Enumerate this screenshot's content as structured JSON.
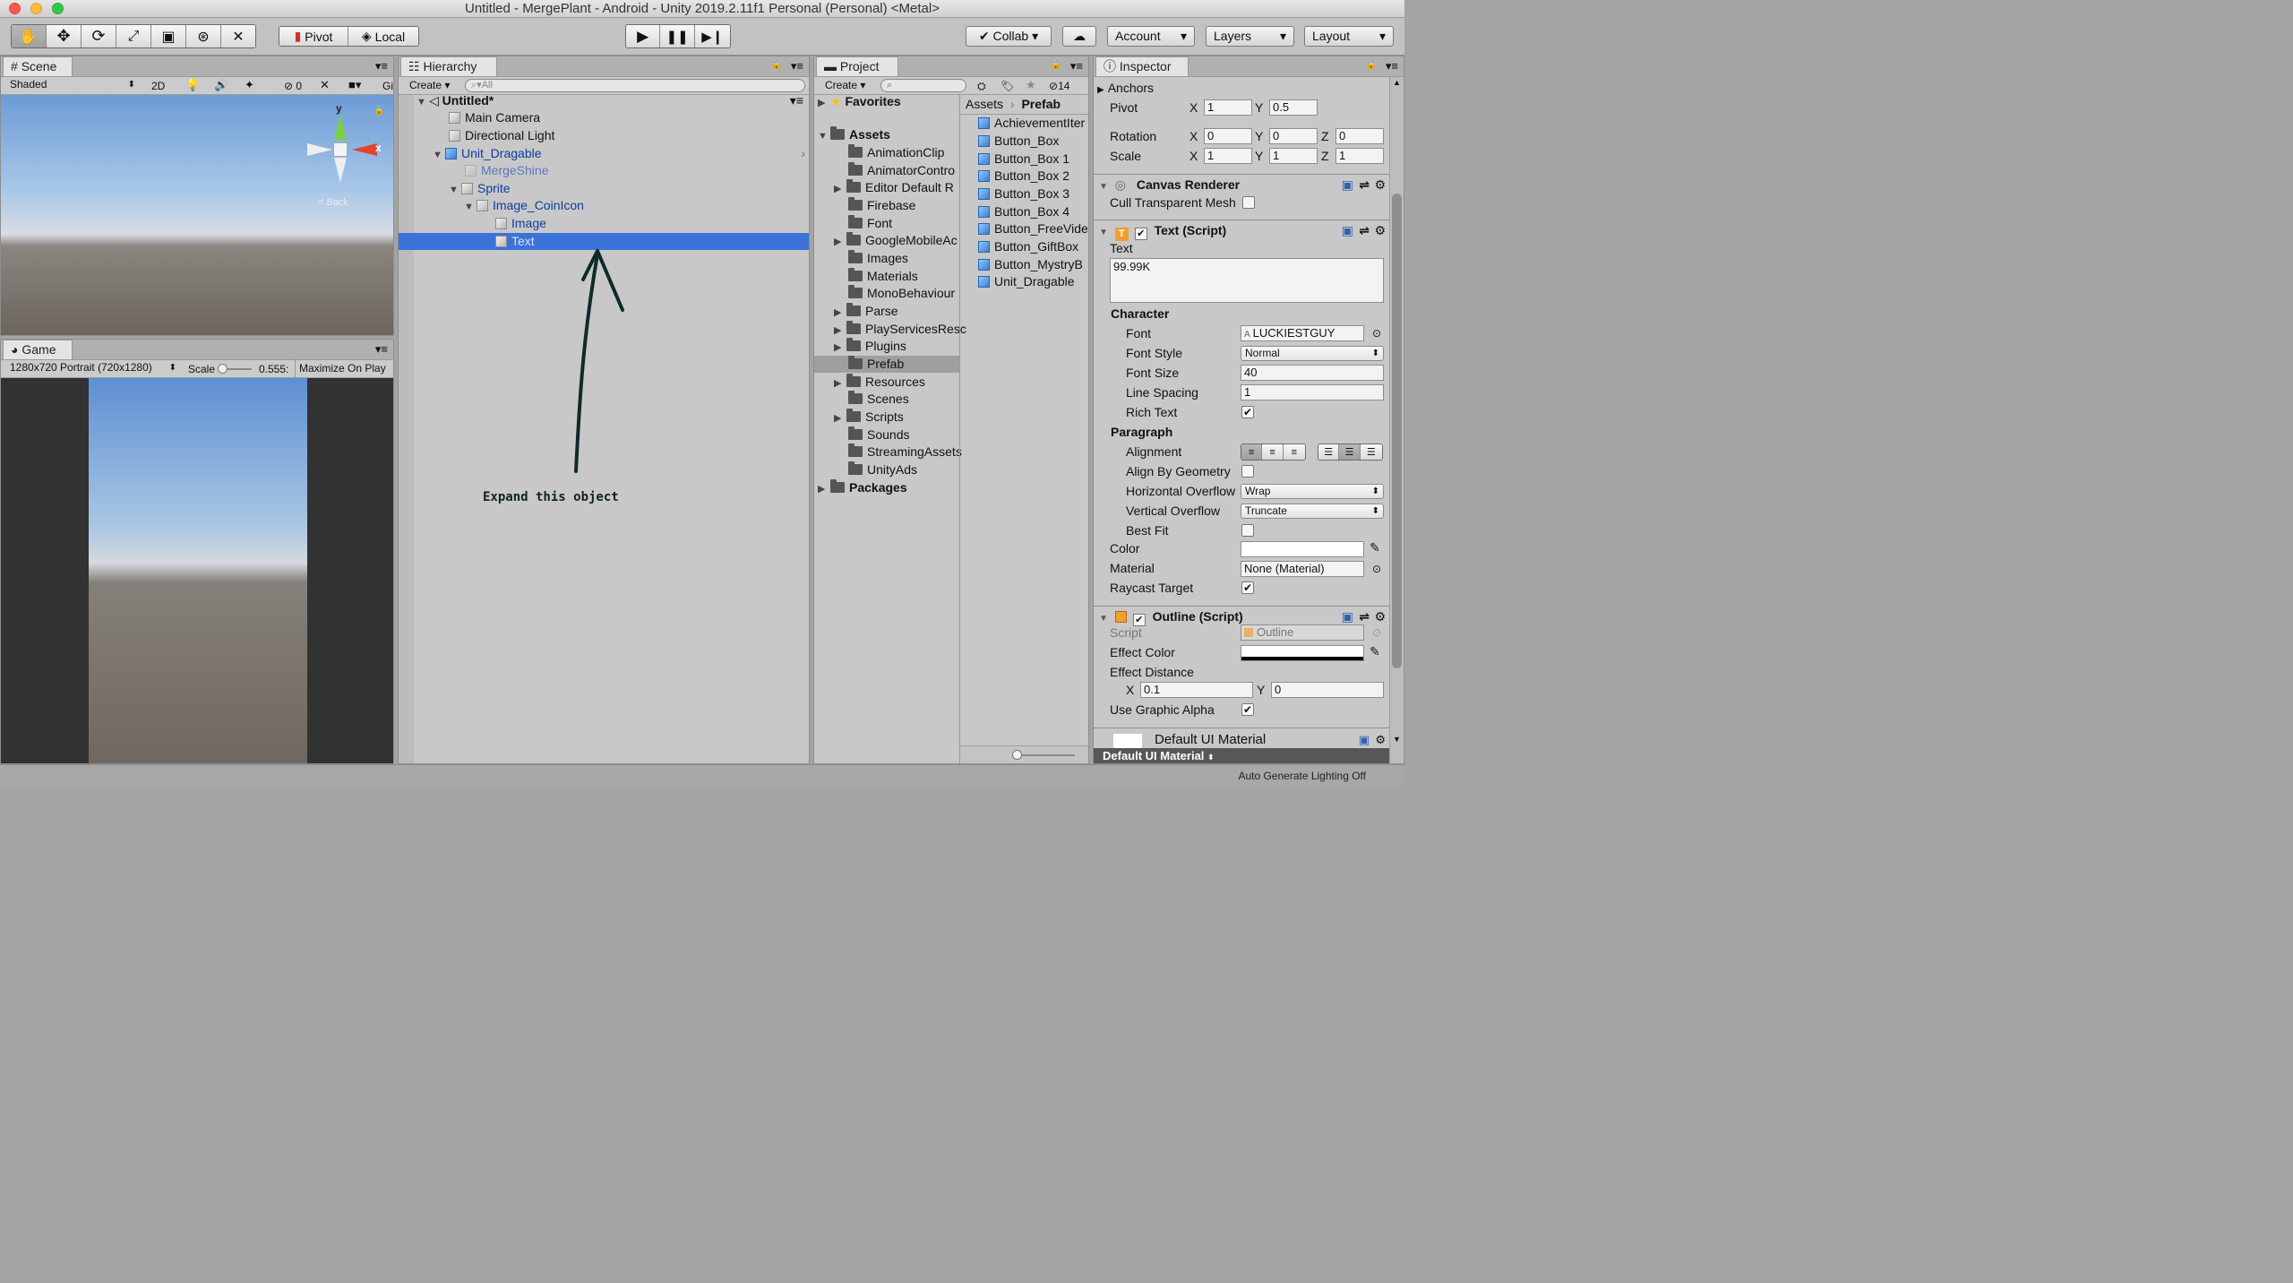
{
  "window": {
    "title": "Untitled - MergePlant - Android - Unity 2019.2.11f1 Personal (Personal) <Metal>"
  },
  "toolbar": {
    "pivot_label": "Pivot",
    "local_label": "Local",
    "collab_label": "Collab",
    "account_label": "Account",
    "layers_label": "Layers",
    "layout_label": "Layout"
  },
  "scene": {
    "tab_label": "Scene",
    "shading_mode": "Shaded",
    "mode_2d": "2D",
    "hidden_count": "0",
    "gizmos_label": "Gi",
    "gizmo_y": "y",
    "gizmo_x": "x",
    "back_label": "< Back"
  },
  "game": {
    "tab_label": "Game",
    "resolution": "1280x720 Portrait (720x1280)",
    "scale_label": "Scale",
    "scale_value": "0.555:",
    "maximize_label": "Maximize On Play"
  },
  "hierarchy": {
    "tab_label": "Hierarchy",
    "create_label": "Create",
    "search_placeholder": "All",
    "scene_name": "Untitled*",
    "items": [
      {
        "label": "Main Camera"
      },
      {
        "label": "Directional Light"
      },
      {
        "label": "Unit_Dragable"
      },
      {
        "label": "MergeShine"
      },
      {
        "label": "Sprite"
      },
      {
        "label": "Image_CoinIcon"
      },
      {
        "label": "Image"
      },
      {
        "label": "Text"
      }
    ],
    "annotation": "Expand this object"
  },
  "project": {
    "tab_label": "Project",
    "create_label": "Create",
    "hidden_count": "14",
    "favorites_label": "Favorites",
    "assets_label": "Assets",
    "packages_label": "Packages",
    "folders": [
      {
        "label": "AnimationClip"
      },
      {
        "label": "AnimatorContro"
      },
      {
        "label": "Editor Default R"
      },
      {
        "label": "Firebase"
      },
      {
        "label": "Font"
      },
      {
        "label": "GoogleMobileAc"
      },
      {
        "label": "Images"
      },
      {
        "label": "Materials"
      },
      {
        "label": "MonoBehaviour"
      },
      {
        "label": "Parse"
      },
      {
        "label": "PlayServicesResc"
      },
      {
        "label": "Plugins"
      },
      {
        "label": "Prefab"
      },
      {
        "label": "Resources"
      },
      {
        "label": "Scenes"
      },
      {
        "label": "Scripts"
      },
      {
        "label": "Sounds"
      },
      {
        "label": "StreamingAssets"
      },
      {
        "label": "UnityAds"
      }
    ],
    "breadcrumb": {
      "root": "Assets",
      "current": "Prefab"
    },
    "files": [
      {
        "label": "AchievementIter"
      },
      {
        "label": "Button_Box"
      },
      {
        "label": "Button_Box 1"
      },
      {
        "label": "Button_Box 2"
      },
      {
        "label": "Button_Box 3"
      },
      {
        "label": "Button_Box 4"
      },
      {
        "label": "Button_FreeVide"
      },
      {
        "label": "Button_GiftBox"
      },
      {
        "label": "Button_MystryB"
      },
      {
        "label": "Unit_Dragable"
      }
    ]
  },
  "inspector": {
    "tab_label": "Inspector",
    "anchors_label": "Anchors",
    "pivot": {
      "label": "Pivot",
      "x": "1",
      "y": "0.5"
    },
    "rotation": {
      "label": "Rotation",
      "x": "0",
      "y": "0",
      "z": "0"
    },
    "scale": {
      "label": "Scale",
      "x": "1",
      "y": "1",
      "z": "1"
    },
    "axis_x": "X",
    "axis_y": "Y",
    "axis_z": "Z",
    "canvas_renderer": {
      "title": "Canvas Renderer",
      "cull_label": "Cull Transparent Mesh"
    },
    "text_script": {
      "title": "Text (Script)",
      "text_label": "Text",
      "text_value": "99.99K",
      "character_label": "Character",
      "font_label": "Font",
      "font_value": "LUCKIESTGUY",
      "font_style_label": "Font Style",
      "font_style_value": "Normal",
      "font_size_label": "Font Size",
      "font_size_value": "40",
      "line_spacing_label": "Line Spacing",
      "line_spacing_value": "1",
      "rich_text_label": "Rich Text",
      "paragraph_label": "Paragraph",
      "alignment_label": "Alignment",
      "align_geometry_label": "Align By Geometry",
      "h_overflow_label": "Horizontal Overflow",
      "h_overflow_value": "Wrap",
      "v_overflow_label": "Vertical Overflow",
      "v_overflow_value": "Truncate",
      "best_fit_label": "Best Fit",
      "color_label": "Color",
      "material_label": "Material",
      "material_value": "None (Material)",
      "raycast_label": "Raycast Target"
    },
    "outline_script": {
      "title": "Outline (Script)",
      "script_label": "Script",
      "script_value": "Outline",
      "effect_color_label": "Effect Color",
      "effect_distance_label": "Effect Distance",
      "distance_x": "0.1",
      "distance_y": "0",
      "graphic_alpha_label": "Use Graphic Alpha"
    },
    "material_preview": {
      "title": "Default UI Material",
      "dropdown": "Default UI Material"
    }
  },
  "status_bar": {
    "text": "Auto Generate Lighting Off"
  },
  "colors": {
    "selection": "#3a72d8",
    "hierarchy_blue": "#0f3a9e",
    "scene_sky": "#8fb8e0",
    "ground": "#6e665f"
  }
}
